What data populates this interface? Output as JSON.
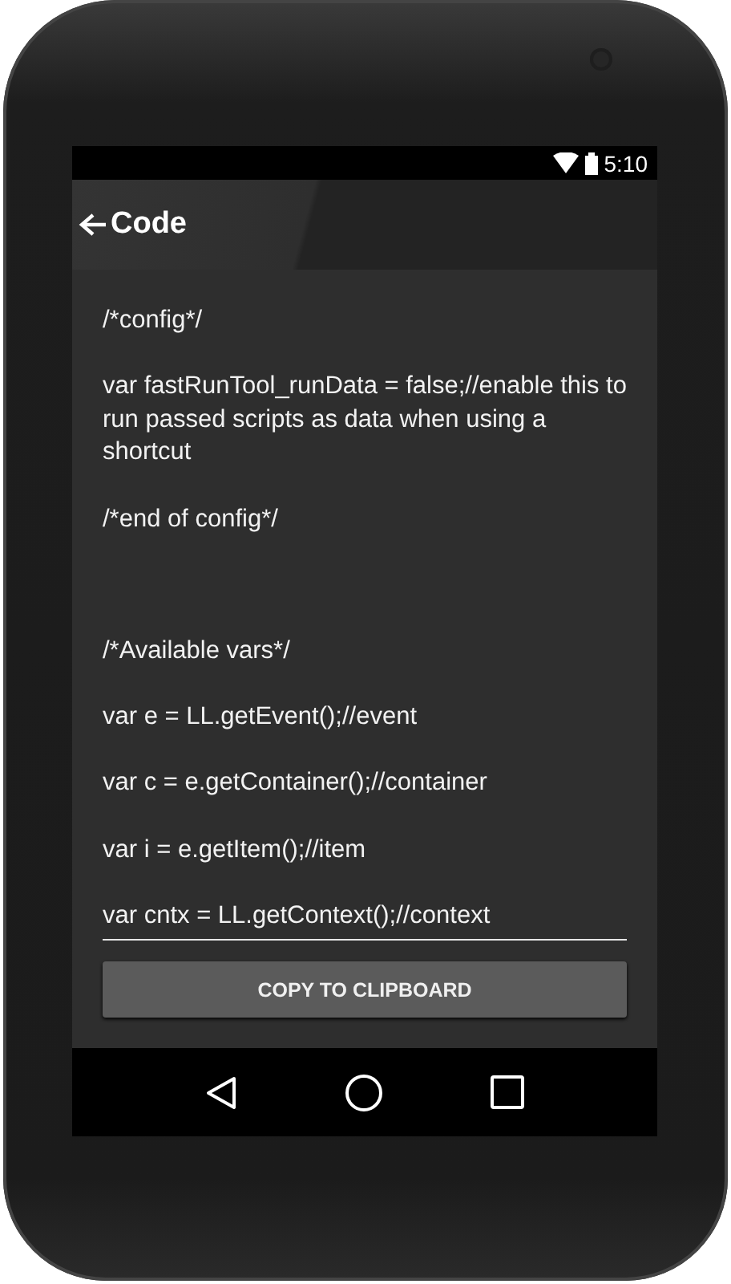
{
  "status_bar": {
    "time": "5:10"
  },
  "app_bar": {
    "title": "Code"
  },
  "code_field": {
    "value": "/*config*/\n\nvar fastRunTool_runData = false;//enable this to run passed scripts as data when using a shortcut\n\n/*end of config*/\n\n\n\n/*Available vars*/\n\nvar e = LL.getEvent();//event\n\nvar c = e.getContainer();//container\n\nvar i = e.getItem();//item\n\nvar cntx = LL.getContext();//context"
  },
  "button": {
    "label": "COPY TO CLIPBOARD"
  }
}
